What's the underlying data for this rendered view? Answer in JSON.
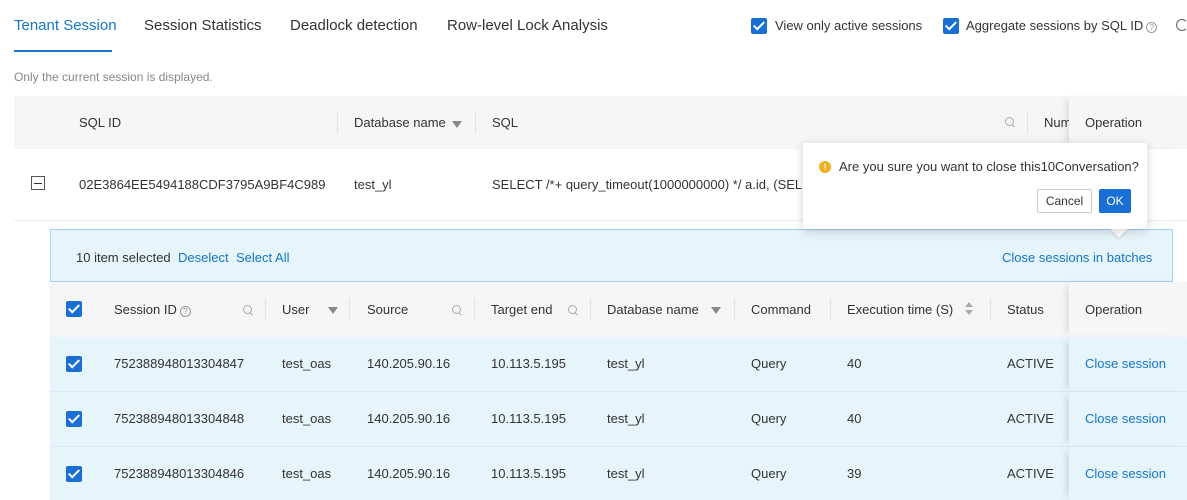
{
  "tabs": [
    {
      "label": "Tenant Session",
      "active": true
    },
    {
      "label": "Session Statistics",
      "active": false
    },
    {
      "label": "Deadlock detection",
      "active": false
    },
    {
      "label": "Row-level Lock Analysis",
      "active": false
    }
  ],
  "options": {
    "active_only": {
      "label": "View only active sessions",
      "checked": true
    },
    "aggregate": {
      "label": "Aggregate sessions by SQL ID",
      "checked": true
    }
  },
  "note": "Only the current session is displayed.",
  "outer_table": {
    "headers": {
      "sql_id": "SQL ID",
      "database_name": "Database name",
      "sql": "SQL",
      "num": "Num",
      "operation": "Operation"
    },
    "row": {
      "sql_id": "02E3864EE5494188CDF3795A9BF4C989",
      "database_name": "test_yl",
      "sql": "SELECT /*+ query_timeout(1000000000) */ a.id, (SELE"
    }
  },
  "selection_bar": {
    "count_text": "10 item selected",
    "deselect": "Deselect",
    "select_all": "Select All",
    "batch_close": "Close sessions in batches"
  },
  "inner_table": {
    "headers": {
      "session_id": "Session ID",
      "user": "User",
      "source": "Source",
      "target_end": "Target end",
      "database_name": "Database name",
      "command": "Command",
      "execution_time": "Execution time (S)",
      "status": "Status",
      "operation": "Operation"
    },
    "rows": [
      {
        "session_id": "752388948013304847",
        "user": "test_oas",
        "source": "140.205.90.16",
        "target_end": "10.113.5.195",
        "database_name": "test_yl",
        "command": "Query",
        "execution_time": "40",
        "status": "ACTIVE",
        "action": "Close session",
        "checked": true
      },
      {
        "session_id": "752388948013304848",
        "user": "test_oas",
        "source": "140.205.90.16",
        "target_end": "10.113.5.195",
        "database_name": "test_yl",
        "command": "Query",
        "execution_time": "40",
        "status": "ACTIVE",
        "action": "Close session",
        "checked": true
      },
      {
        "session_id": "752388948013304846",
        "user": "test_oas",
        "source": "140.205.90.16",
        "target_end": "10.113.5.195",
        "database_name": "test_yl",
        "command": "Query",
        "execution_time": "39",
        "status": "ACTIVE",
        "action": "Close session",
        "checked": true
      }
    ]
  },
  "popconfirm": {
    "message": "Are you sure you want to close this10Conversation?",
    "cancel": "Cancel",
    "ok": "OK"
  },
  "colors": {
    "primary": "#1677c9",
    "selected_row_bg": "#e6f4fb",
    "warning": "#f2b01e"
  },
  "icons": {
    "help": "help-circle-icon",
    "filter": "filter-icon",
    "search": "search-icon",
    "sort": "sort-icon",
    "collapse": "minus-square-icon",
    "warning": "warning-circle-icon",
    "refresh": "refresh-icon"
  }
}
